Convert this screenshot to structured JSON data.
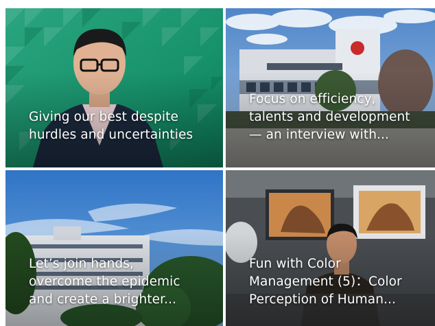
{
  "tiles": [
    {
      "lines": [
        "Giving our best despite",
        "hurdles and uncertainties"
      ],
      "image": "executive-portrait-green-background"
    },
    {
      "lines": [
        "Focus on efficiency,",
        "talents and development",
        "— an interview with..."
      ],
      "image": "factory-building-exterior"
    },
    {
      "lines": [
        "Let’s join hands,",
        "overcome the epidemic",
        "and create a brighter..."
      ],
      "image": "building-under-blue-sky"
    },
    {
      "lines": [
        "Fun with Color",
        "Management (5)：Color",
        "Perception of Human..."
      ],
      "image": "technician-at-color-monitors"
    }
  ],
  "colors": {
    "caption_text": "#ffffff",
    "tile1_green": "#1f9b73",
    "sky_blue": "#3c7fd0"
  }
}
